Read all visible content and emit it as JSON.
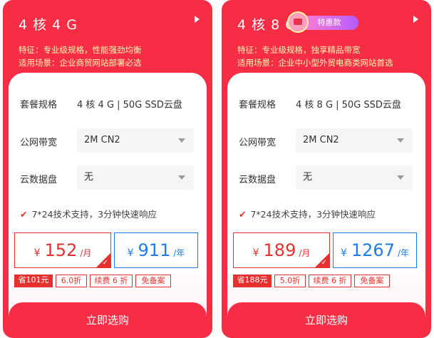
{
  "cards": [
    {
      "title": "4 核 4 G",
      "feature": "特征：专业级规格，性能强劲均衡",
      "scenario": "适用场景：企业商贸网站部署必选",
      "spec_label": "套餐规格",
      "spec_value": "4 核 4 G | 50G SSD云盘",
      "bandwidth_label": "公网带宽",
      "bandwidth_value": "2M CN2",
      "disk_label": "云数据盘",
      "disk_value": "无",
      "support": "7*24技术支持，3分钟快速响应",
      "month_price": {
        "currency": "¥",
        "amount": "152",
        "unit": "/月"
      },
      "year_price": {
        "currency": "¥",
        "amount": "911",
        "unit": "/年"
      },
      "tags": [
        "省101元",
        "6.0折",
        "续费 6 折",
        "免备案"
      ],
      "buy_label": "立即选购",
      "selected_check": "✓"
    },
    {
      "title": "4 核 8 G",
      "promo": "特惠款",
      "feature": "特征：专业级规格，独享精品带宽",
      "scenario": "适用场景：企业中小型外贸电商类网站首选",
      "spec_label": "套餐规格",
      "spec_value": "4 核 8 G | 50G SSD云盘",
      "bandwidth_label": "公网带宽",
      "bandwidth_value": "2M CN2",
      "disk_label": "云数据盘",
      "disk_value": "无",
      "support": "7*24技术支持，3分钟快速响应",
      "month_price": {
        "currency": "¥",
        "amount": "189",
        "unit": "/月"
      },
      "year_price": {
        "currency": "¥",
        "amount": "1267",
        "unit": "/年"
      },
      "tags": [
        "省188元",
        "5.0折",
        "续费 6 折",
        "免备案"
      ],
      "buy_label": "立即选购",
      "selected_check": "✓"
    }
  ],
  "colors": {
    "brand_red": "#f72d45",
    "accent_red": "#e5302e",
    "year_blue": "#1e7ce8",
    "feature_yellow": "#fff4b0",
    "promo_gradient": [
      "#ff7fd0",
      "#b45bff"
    ]
  },
  "icons": {
    "arrow": "caret-right-icon",
    "select": "chevron-down-icon",
    "check": "check-icon",
    "promo": "gift-icon"
  }
}
